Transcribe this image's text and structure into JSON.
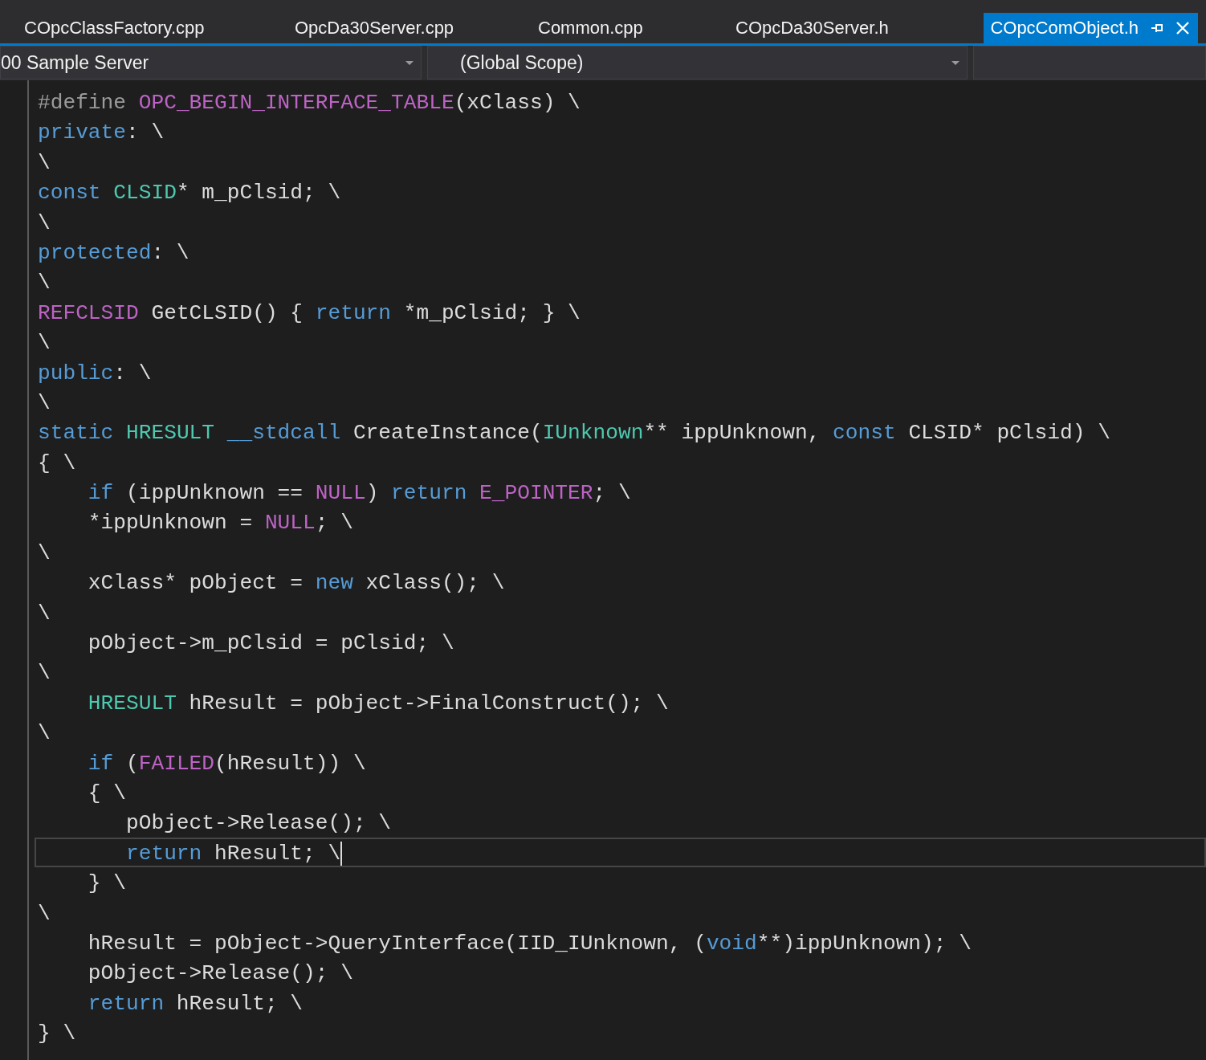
{
  "tabs": [
    {
      "label": "COpcClassFactory.cpp",
      "selected": false
    },
    {
      "label": "OpcDa30Server.cpp",
      "selected": false
    },
    {
      "label": "Common.cpp",
      "selected": false
    },
    {
      "label": "COpcDa30Server.h",
      "selected": false
    },
    {
      "label": "COpcComObject.h",
      "selected": true
    }
  ],
  "navigation_bar": {
    "project": "00 Sample Server",
    "scope": "(Global Scope)"
  },
  "code_lines": [
    {
      "current": false,
      "tokens": [
        {
          "text": "#define ",
          "kind": "preproc"
        },
        {
          "text": "OPC_BEGIN_INTERFACE_TABLE",
          "kind": "macro"
        },
        {
          "text": "(xClass) \\",
          "kind": "plain"
        }
      ]
    },
    {
      "current": false,
      "tokens": [
        {
          "text": "private",
          "kind": "keyword"
        },
        {
          "text": ": \\",
          "kind": "plain"
        }
      ]
    },
    {
      "current": false,
      "tokens": [
        {
          "text": "\\",
          "kind": "plain"
        }
      ]
    },
    {
      "current": false,
      "tokens": [
        {
          "text": "const ",
          "kind": "keyword"
        },
        {
          "text": "CLSID",
          "kind": "type"
        },
        {
          "text": "* m_pClsid; \\",
          "kind": "plain"
        }
      ]
    },
    {
      "current": false,
      "tokens": [
        {
          "text": "\\",
          "kind": "plain"
        }
      ]
    },
    {
      "current": false,
      "tokens": [
        {
          "text": "protected",
          "kind": "keyword"
        },
        {
          "text": ": \\",
          "kind": "plain"
        }
      ]
    },
    {
      "current": false,
      "tokens": [
        {
          "text": "\\",
          "kind": "plain"
        }
      ]
    },
    {
      "current": false,
      "tokens": [
        {
          "text": "REFCLSID",
          "kind": "macro"
        },
        {
          "text": " GetCLSID() { ",
          "kind": "plain"
        },
        {
          "text": "return",
          "kind": "keyword"
        },
        {
          "text": " *m_pClsid; } \\",
          "kind": "plain"
        }
      ]
    },
    {
      "current": false,
      "tokens": [
        {
          "text": "\\",
          "kind": "plain"
        }
      ]
    },
    {
      "current": false,
      "tokens": [
        {
          "text": "public",
          "kind": "keyword"
        },
        {
          "text": ": \\",
          "kind": "plain"
        }
      ]
    },
    {
      "current": false,
      "tokens": [
        {
          "text": "\\",
          "kind": "plain"
        }
      ]
    },
    {
      "current": false,
      "tokens": [
        {
          "text": "static ",
          "kind": "keyword"
        },
        {
          "text": "HRESULT ",
          "kind": "type"
        },
        {
          "text": "__stdcall",
          "kind": "keyword"
        },
        {
          "text": " CreateInstance(",
          "kind": "plain"
        },
        {
          "text": "IUnknown",
          "kind": "type"
        },
        {
          "text": "** ippUnknown, ",
          "kind": "plain"
        },
        {
          "text": "const",
          "kind": "keyword"
        },
        {
          "text": " CLSID* pClsid) \\",
          "kind": "plain"
        }
      ]
    },
    {
      "current": false,
      "tokens": [
        {
          "text": "{ \\",
          "kind": "plain"
        }
      ]
    },
    {
      "current": false,
      "tokens": [
        {
          "text": "    if",
          "kind": "keyword"
        },
        {
          "text": " (ippUnknown == ",
          "kind": "plain"
        },
        {
          "text": "NULL",
          "kind": "macro"
        },
        {
          "text": ") ",
          "kind": "plain"
        },
        {
          "text": "return ",
          "kind": "keyword"
        },
        {
          "text": "E_POINTER",
          "kind": "macro"
        },
        {
          "text": "; \\",
          "kind": "plain"
        }
      ]
    },
    {
      "current": false,
      "tokens": [
        {
          "text": "    *ippUnknown = ",
          "kind": "plain"
        },
        {
          "text": "NULL",
          "kind": "macro"
        },
        {
          "text": "; \\",
          "kind": "plain"
        }
      ]
    },
    {
      "current": false,
      "tokens": [
        {
          "text": "\\",
          "kind": "plain"
        }
      ]
    },
    {
      "current": false,
      "tokens": [
        {
          "text": "    xClass* pObject = ",
          "kind": "plain"
        },
        {
          "text": "new",
          "kind": "keyword"
        },
        {
          "text": " xClass(); \\",
          "kind": "plain"
        }
      ]
    },
    {
      "current": false,
      "tokens": [
        {
          "text": "\\",
          "kind": "plain"
        }
      ]
    },
    {
      "current": false,
      "tokens": [
        {
          "text": "    pObject->m_pClsid = pClsid; \\",
          "kind": "plain"
        }
      ]
    },
    {
      "current": false,
      "tokens": [
        {
          "text": "\\",
          "kind": "plain"
        }
      ]
    },
    {
      "current": false,
      "tokens": [
        {
          "text": "    HRESULT",
          "kind": "type"
        },
        {
          "text": " hResult = pObject->FinalConstruct(); \\",
          "kind": "plain"
        }
      ]
    },
    {
      "current": false,
      "tokens": [
        {
          "text": "\\",
          "kind": "plain"
        }
      ]
    },
    {
      "current": false,
      "tokens": [
        {
          "text": "    if",
          "kind": "keyword"
        },
        {
          "text": " (",
          "kind": "plain"
        },
        {
          "text": "FAILED",
          "kind": "macro"
        },
        {
          "text": "(hResult)) \\",
          "kind": "plain"
        }
      ]
    },
    {
      "current": false,
      "tokens": [
        {
          "text": "    { \\",
          "kind": "plain"
        }
      ]
    },
    {
      "current": false,
      "tokens": [
        {
          "text": "       pObject->Release(); \\",
          "kind": "plain"
        }
      ]
    },
    {
      "current": true,
      "tokens": [
        {
          "text": "       return",
          "kind": "keyword"
        },
        {
          "text": " hResult; \\",
          "kind": "plain"
        }
      ]
    },
    {
      "current": false,
      "tokens": [
        {
          "text": "    } \\",
          "kind": "plain"
        }
      ]
    },
    {
      "current": false,
      "tokens": [
        {
          "text": "\\",
          "kind": "plain"
        }
      ]
    },
    {
      "current": false,
      "tokens": [
        {
          "text": "    hResult = pObject->QueryInterface(IID_IUnknown, (",
          "kind": "plain"
        },
        {
          "text": "void",
          "kind": "keyword"
        },
        {
          "text": "**)ippUnknown); \\",
          "kind": "plain"
        }
      ]
    },
    {
      "current": false,
      "tokens": [
        {
          "text": "    pObject->Release(); \\",
          "kind": "plain"
        }
      ]
    },
    {
      "current": false,
      "tokens": [
        {
          "text": "    return",
          "kind": "keyword"
        },
        {
          "text": " hResult; \\",
          "kind": "plain"
        }
      ]
    },
    {
      "current": false,
      "tokens": [
        {
          "text": "} \\",
          "kind": "plain"
        }
      ]
    }
  ]
}
